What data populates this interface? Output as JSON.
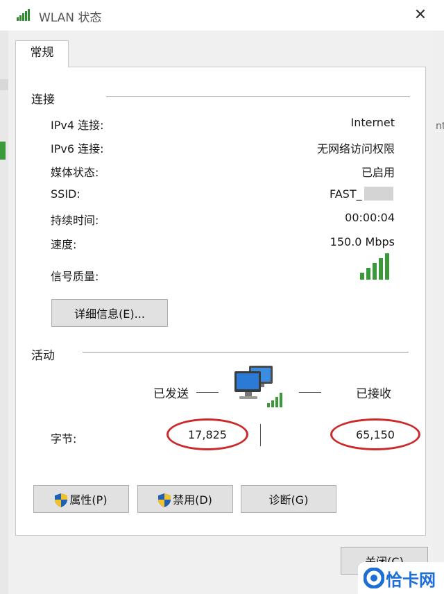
{
  "window": {
    "title": "WLAN 状态",
    "close_glyph": "✕"
  },
  "tabs": [
    {
      "label": "常规"
    }
  ],
  "connection": {
    "section_title": "连接",
    "rows": [
      {
        "label": "IPv4 连接:",
        "value": "Internet"
      },
      {
        "label": "IPv6 连接:",
        "value": "无网络访问权限"
      },
      {
        "label": "媒体状态:",
        "value": "已启用"
      },
      {
        "label": "SSID:",
        "value": "FAST_"
      },
      {
        "label": "持续时间:",
        "value": "00:00:04"
      },
      {
        "label": "速度:",
        "value": "150.0 Mbps"
      }
    ],
    "signal_label": "信号质量:",
    "details_button": "详细信息(E)..."
  },
  "activity": {
    "section_title": "活动",
    "sent_label": "已发送",
    "received_label": "已接收",
    "bytes_label": "字节:",
    "bytes_sent": "17,825",
    "bytes_received": "65,150"
  },
  "buttons": {
    "properties": "属性(P)",
    "disable": "禁用(D)",
    "diagnose": "诊断(G)",
    "close": "关闭(C)"
  },
  "watermark": {
    "text": "恰卡网"
  },
  "icons": {
    "title": "wifi-signal-icon",
    "signal": "signal-bars-icon",
    "network": "network-computers-icon",
    "shield": "uac-shield-icon"
  },
  "colors": {
    "signal_green": "#3a9a3a",
    "annotation_red": "#cc2a2a",
    "watermark_blue": "#1d6fd6"
  }
}
